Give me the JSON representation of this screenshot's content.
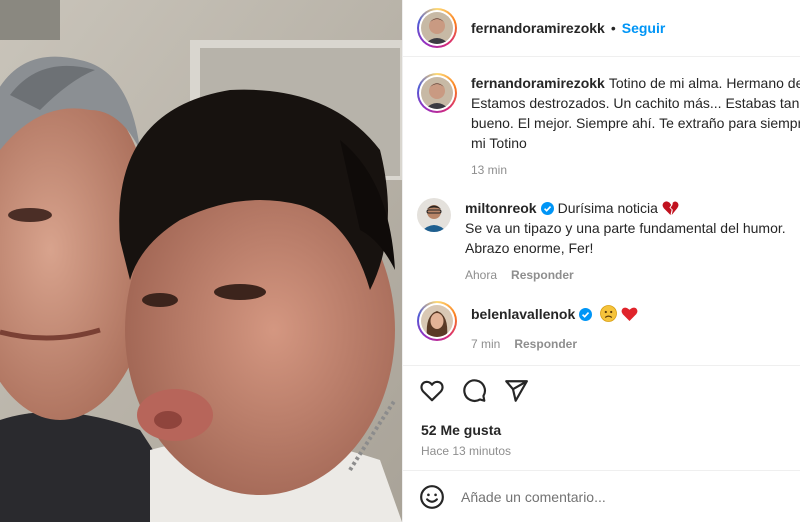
{
  "post": {
    "author": "fernandoramirezokk",
    "follow_label": "Seguir",
    "separator": "•",
    "caption": {
      "username": "fernandoramirezokk",
      "lines": [
        "Totino de mi alma. Hermano de",
        "Estamos destrozados. Un cachito más... Estabas tan f",
        "bueno. El mejor. Siempre ahí. Te extraño para siempr",
        "mi Totino"
      ],
      "time": "13 min"
    },
    "comments": [
      {
        "username": "miltonreok",
        "verified": true,
        "lines": [
          "Durísima noticia",
          "Se va un tipazo y una parte fundamental del humor.",
          "Abrazo enorme, Fer!"
        ],
        "emoji": "broken-heart",
        "time": "Ahora",
        "reply_label": "Responder"
      },
      {
        "username": "belenlavallenok",
        "verified": true,
        "lines": [
          ""
        ],
        "emoji": "sad-face, red-heart",
        "time": "7 min",
        "reply_label": "Responder"
      }
    ],
    "likes": "52 Me gusta",
    "posted": "Hace 13 minutos",
    "comment_placeholder": "Añade un comentario..."
  },
  "colors": {
    "accent": "#0095f6",
    "text": "#262626",
    "muted": "#8e8e8e",
    "border": "#efefef"
  }
}
